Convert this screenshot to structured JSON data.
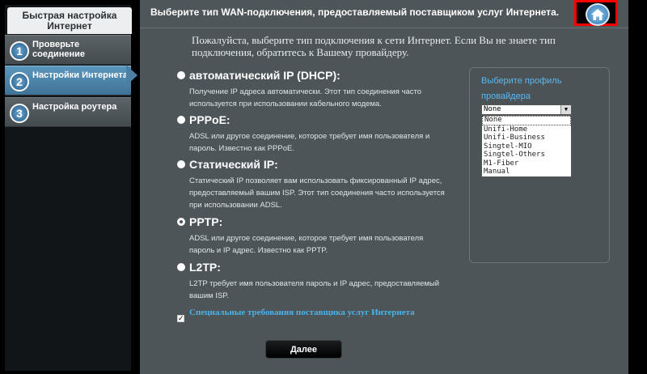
{
  "sidebar": {
    "title": "Быстрая настройка Интернет",
    "steps": [
      {
        "num": "1",
        "label": "Проверьте соединение"
      },
      {
        "num": "2",
        "label": "Настройки Интернета"
      },
      {
        "num": "3",
        "label": "Настройка роутера"
      }
    ],
    "active_step": 2
  },
  "header": {
    "title": "Выберите тип WAN-подключения, предоставляемый поставщиком услуг Интернета.",
    "home_icon": "home-icon"
  },
  "intro": "Пожалуйста, выберите тип подключения к сети Интернет. Если Вы не знаете тип подключения, обратитесь к Вашему провайдеру.",
  "options": [
    {
      "title": "автоматический IP (DHCP):",
      "desc": "Получение IP адреса автоматически. Этот тип соединения часто используется при использовании кабельного модема."
    },
    {
      "title": "PPPoE:",
      "desc": "ADSL или другое соединение, которое требует имя пользователя и пароль. Известно как PPPoE."
    },
    {
      "title": "Статический IP:",
      "desc": "Статический IP позволяет вам использовать фиксированный IP адрес, предоставляемый вашим ISP. Этот тип соединения часто используется при использовании ADSL."
    },
    {
      "title": "PPTP:",
      "desc": "ADSL или другое соединение, которое требует имя пользователя пароль и IP адрес. Известно как PPTP."
    },
    {
      "title": "L2TP:",
      "desc": "L2TP требует имя пользователя пароль и IP адрес, предоставляемый вашим ISP."
    }
  ],
  "selected_option": 4,
  "special": {
    "label": "Специальные требования поставщика услуг Интернета",
    "checked": true
  },
  "provider": {
    "label": "Выберите профиль провайдера",
    "selected": "None",
    "options": [
      "None",
      "Unifi-Home",
      "Unifi-Business",
      "Singtel-MIO",
      "Singtel-Others",
      "M1-Fiber",
      "Manual"
    ]
  },
  "next_label": "Далее"
}
